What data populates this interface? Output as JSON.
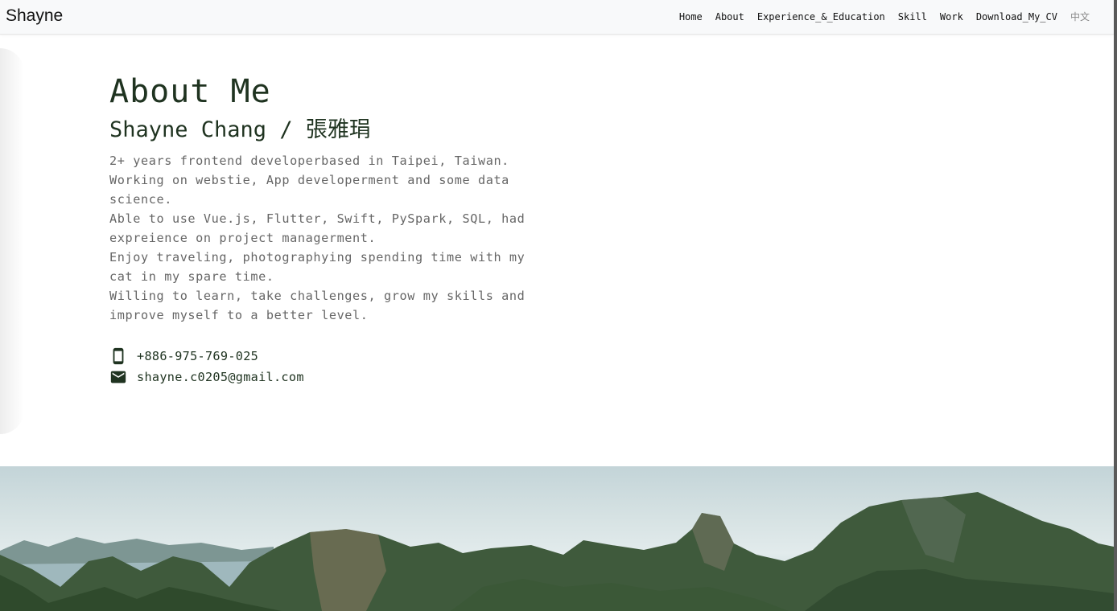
{
  "navbar": {
    "brand": "Shayne",
    "links": [
      {
        "label": "Home"
      },
      {
        "label": "About"
      },
      {
        "label": "Experience_&_Education"
      },
      {
        "label": "Skill"
      },
      {
        "label": "Work"
      },
      {
        "label": "Download_My_CV"
      },
      {
        "label": "中文"
      }
    ]
  },
  "about": {
    "title": "About Me",
    "name": "Shayne Chang / 張雅琄",
    "bio": [
      "2+ years frontend developerbased in Taipei, Taiwan.",
      "Working on webstie, App developerment and some data science.",
      "Able to use Vue.js, Flutter, Swift, PySpark, SQL, had expreience on project managerment.",
      "Enjoy traveling, photographying spending time with my cat in my spare time.",
      "Willing to learn, take challenges, grow my skills and improve myself to a better level."
    ],
    "contacts": {
      "phone": "+886-975-769-025",
      "email": "shayne.c0205@gmail.com"
    }
  },
  "colors": {
    "heading": "#1f3320",
    "body_text": "#666666",
    "navbar_bg": "#f8f9fa"
  },
  "icons": {
    "phone": "smartphone-icon",
    "email": "mail-icon"
  }
}
